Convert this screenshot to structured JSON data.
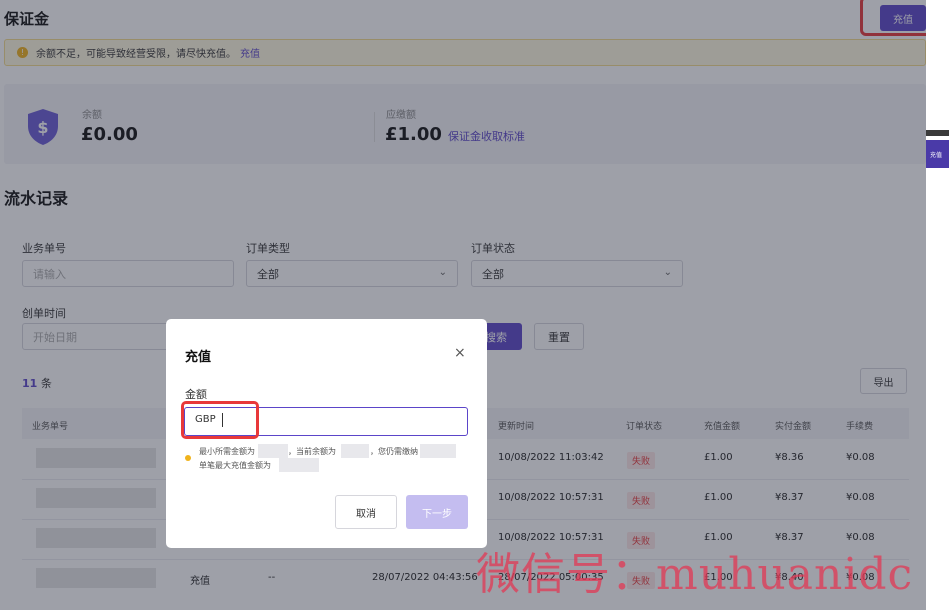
{
  "header": {
    "title": "保证金",
    "topup_label": "充值"
  },
  "alert": {
    "text": "余额不足，可能导致经营受限，请尽快充值。",
    "link": "充值"
  },
  "balance": {
    "balance_label": "余额",
    "balance_value": "£0.00",
    "due_label": "应缴额",
    "due_value": "£1.00",
    "fee_link": "保证金收取标准"
  },
  "records": {
    "title": "流水记录",
    "filters": {
      "order_no_label": "业务单号",
      "order_no_placeholder": "请输入",
      "order_type_label": "订单类型",
      "order_type_value": "全部",
      "order_status_label": "订单状态",
      "order_status_value": "全部",
      "created_label": "创单时间",
      "start_date_placeholder": "开始日期",
      "search_label": "搜索",
      "reset_label": "重置"
    },
    "count_num": "11",
    "count_unit": "条",
    "export_label": "导出",
    "columns": [
      "业务单号",
      "更新时间",
      "订单状态",
      "充值金额",
      "实付金额",
      "手续费"
    ],
    "rows": [
      {
        "updated": "10/08/2022 11:03:42",
        "status": "失败",
        "amount": "£1.00",
        "paid": "¥8.36",
        "fee": "¥0.08"
      },
      {
        "updated": "10/08/2022 10:57:31",
        "status": "失败",
        "amount": "£1.00",
        "paid": "¥8.37",
        "fee": "¥0.08"
      },
      {
        "updated": "10/08/2022 10:57:31",
        "status": "失败",
        "amount": "£1.00",
        "paid": "¥8.37",
        "fee": "¥0.08"
      },
      {
        "type": "充值",
        "dash": "--",
        "created": "28/07/2022 04:43:56",
        "updated": "28/07/2022 05:00:35",
        "status": "失败",
        "amount": "£1.00",
        "paid": "¥8.40",
        "fee": "¥0.08"
      }
    ]
  },
  "modal": {
    "title": "充值",
    "close": "×",
    "amount_label": "金额",
    "currency_prefix": "GBP",
    "hint_line1_a": "最小所需金额为",
    "hint_line1_b": "，当前余额为",
    "hint_line1_c": "，您仍需缴纳",
    "hint_line2": "单笔最大充值金额为",
    "cancel_label": "取消",
    "next_label": "下一步"
  },
  "side_strip": {
    "label": "充值"
  },
  "watermark": "微信号：muhuanidc",
  "colors": {
    "accent": "#5b45c9",
    "warning": "#f0b31c",
    "danger": "#e8383a",
    "highlight_box": "#e8383a"
  }
}
